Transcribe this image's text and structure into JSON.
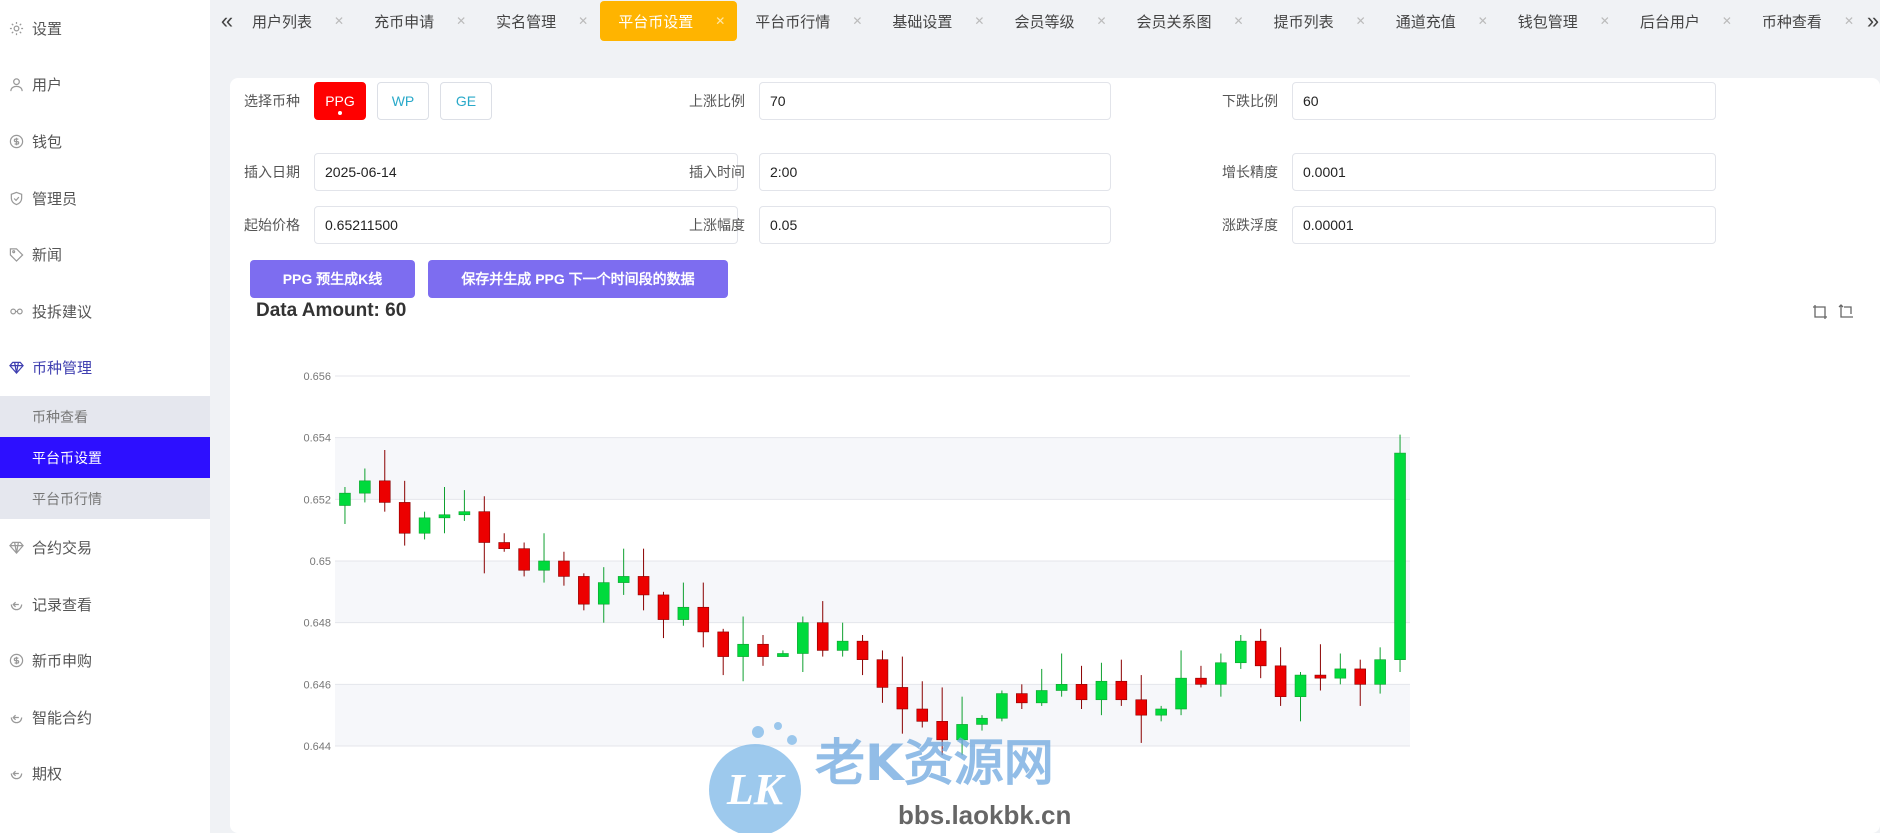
{
  "sidebar": {
    "items": [
      {
        "label": "设置",
        "icon": "gear-icon"
      },
      {
        "label": "用户",
        "icon": "user-icon"
      },
      {
        "label": "钱包",
        "icon": "dollar-icon"
      },
      {
        "label": "管理员",
        "icon": "shield-icon"
      },
      {
        "label": "新闻",
        "icon": "tag-icon"
      },
      {
        "label": "投拆建议",
        "icon": "link-icon"
      },
      {
        "label": "币种管理",
        "icon": "diamond-icon"
      }
    ],
    "sub_items": [
      {
        "label": "币种查看"
      },
      {
        "label": "平台币设置"
      },
      {
        "label": "平台币行情"
      }
    ],
    "items_after": [
      {
        "label": "合约交易",
        "icon": "diamond-icon"
      },
      {
        "label": "记录查看",
        "icon": "circle-arrow-icon"
      },
      {
        "label": "新币申购",
        "icon": "dollar-icon"
      },
      {
        "label": "智能合约",
        "icon": "circle-arrow-icon"
      },
      {
        "label": "期权",
        "icon": "circle-arrow-icon"
      }
    ]
  },
  "tabs": [
    {
      "label": "用户列表"
    },
    {
      "label": "充币申请"
    },
    {
      "label": "实名管理"
    },
    {
      "label": "平台币设置",
      "active": true
    },
    {
      "label": "平台币行情"
    },
    {
      "label": "基础设置"
    },
    {
      "label": "会员等级"
    },
    {
      "label": "会员关系图"
    },
    {
      "label": "提币列表"
    },
    {
      "label": "通道充值"
    },
    {
      "label": "钱包管理"
    },
    {
      "label": "后台用户"
    },
    {
      "label": "币种查看"
    }
  ],
  "form": {
    "coin_label": "选择币种",
    "coins": [
      "PPG",
      "WP",
      "GE"
    ],
    "selected_coin": "PPG",
    "rise_ratio_label": "上涨比例",
    "rise_ratio": "70",
    "fall_ratio_label": "下跌比例",
    "fall_ratio": "60",
    "insert_date_label": "插入日期",
    "insert_date": "2025-06-14",
    "insert_time_label": "插入时间",
    "insert_time": "2:00",
    "growth_precision_label": "增长精度",
    "growth_precision": "0.0001",
    "start_price_label": "起始价格",
    "start_price": "0.65211500",
    "rise_amp_label": "上涨幅度",
    "rise_amp": "0.05",
    "fluct_label": "涨跌浮度",
    "fluct": "0.00001"
  },
  "buttons": {
    "pregenerate": "PPG 预生成K线",
    "save_generate": "保存并生成 PPG 下一个时间段的数据"
  },
  "data_amount": "Data Amount: 60",
  "watermark": {
    "logo": "LK",
    "title": "老K资源网",
    "url": "bbs.laokbk.cn"
  },
  "colors": {
    "up": "#00da3c",
    "down": "#ec0000",
    "accent": "#2d0fff",
    "tab_active": "#ffb400",
    "button": "#7d6df0"
  },
  "chart_data": {
    "type": "candlestick",
    "ylim": [
      0.644,
      0.656
    ],
    "yticks": [
      "0.644",
      "0.646",
      "0.648",
      "0.65",
      "0.652",
      "0.654",
      "0.656"
    ],
    "candles": [
      [
        0.6518,
        0.6522,
        0.6512,
        0.6524
      ],
      [
        0.6522,
        0.6526,
        0.6519,
        0.653
      ],
      [
        0.6526,
        0.6519,
        0.6516,
        0.6536
      ],
      [
        0.6519,
        0.6509,
        0.6505,
        0.6526
      ],
      [
        0.6509,
        0.6514,
        0.6507,
        0.6516
      ],
      [
        0.6514,
        0.6515,
        0.6509,
        0.6524
      ],
      [
        0.6515,
        0.6516,
        0.6513,
        0.6523
      ],
      [
        0.6516,
        0.6506,
        0.6496,
        0.6521
      ],
      [
        0.6506,
        0.6504,
        0.6503,
        0.6509
      ],
      [
        0.6504,
        0.6497,
        0.6495,
        0.6506
      ],
      [
        0.6497,
        0.65,
        0.6493,
        0.6509
      ],
      [
        0.65,
        0.6495,
        0.6492,
        0.6503
      ],
      [
        0.6495,
        0.6486,
        0.6484,
        0.6496
      ],
      [
        0.6486,
        0.6493,
        0.648,
        0.6498
      ],
      [
        0.6493,
        0.6495,
        0.6489,
        0.6504
      ],
      [
        0.6495,
        0.6489,
        0.6484,
        0.6504
      ],
      [
        0.6489,
        0.6481,
        0.6475,
        0.649
      ],
      [
        0.6481,
        0.6485,
        0.6479,
        0.6493
      ],
      [
        0.6485,
        0.6477,
        0.6472,
        0.6493
      ],
      [
        0.6477,
        0.6469,
        0.6463,
        0.6478
      ],
      [
        0.6469,
        0.6473,
        0.6461,
        0.6482
      ],
      [
        0.6473,
        0.6469,
        0.6466,
        0.6476
      ],
      [
        0.6469,
        0.647,
        0.6469,
        0.6471
      ],
      [
        0.647,
        0.648,
        0.6464,
        0.6482
      ],
      [
        0.648,
        0.6471,
        0.6469,
        0.6487
      ],
      [
        0.6471,
        0.6474,
        0.6469,
        0.648
      ],
      [
        0.6474,
        0.6468,
        0.6463,
        0.6476
      ],
      [
        0.6468,
        0.6459,
        0.6454,
        0.6471
      ],
      [
        0.6459,
        0.6452,
        0.6444,
        0.6469
      ],
      [
        0.6452,
        0.6448,
        0.6446,
        0.6461
      ],
      [
        0.6448,
        0.6442,
        0.6437,
        0.6459
      ],
      [
        0.6442,
        0.6447,
        0.6437,
        0.6456
      ],
      [
        0.6447,
        0.6449,
        0.6445,
        0.645
      ],
      [
        0.6449,
        0.6457,
        0.6448,
        0.6458
      ],
      [
        0.6457,
        0.6454,
        0.6452,
        0.646
      ],
      [
        0.6454,
        0.6458,
        0.6453,
        0.6465
      ],
      [
        0.6458,
        0.646,
        0.6456,
        0.647
      ],
      [
        0.646,
        0.6455,
        0.6452,
        0.6466
      ],
      [
        0.6455,
        0.6461,
        0.645,
        0.6467
      ],
      [
        0.6461,
        0.6455,
        0.6453,
        0.6468
      ],
      [
        0.6455,
        0.645,
        0.6441,
        0.6463
      ],
      [
        0.645,
        0.6452,
        0.6448,
        0.6453
      ],
      [
        0.6452,
        0.6462,
        0.645,
        0.6471
      ],
      [
        0.6462,
        0.646,
        0.6459,
        0.6466
      ],
      [
        0.646,
        0.6467,
        0.6456,
        0.647
      ],
      [
        0.6467,
        0.6474,
        0.6465,
        0.6476
      ],
      [
        0.6474,
        0.6466,
        0.6462,
        0.6478
      ],
      [
        0.6466,
        0.6456,
        0.6453,
        0.6472
      ],
      [
        0.6456,
        0.6463,
        0.6448,
        0.6464
      ],
      [
        0.6463,
        0.6462,
        0.6458,
        0.6473
      ],
      [
        0.6462,
        0.6465,
        0.646,
        0.647
      ],
      [
        0.6465,
        0.646,
        0.6453,
        0.6468
      ],
      [
        0.646,
        0.6468,
        0.6457,
        0.6472
      ],
      [
        0.6468,
        0.6535,
        0.6464,
        0.6541
      ]
    ]
  }
}
